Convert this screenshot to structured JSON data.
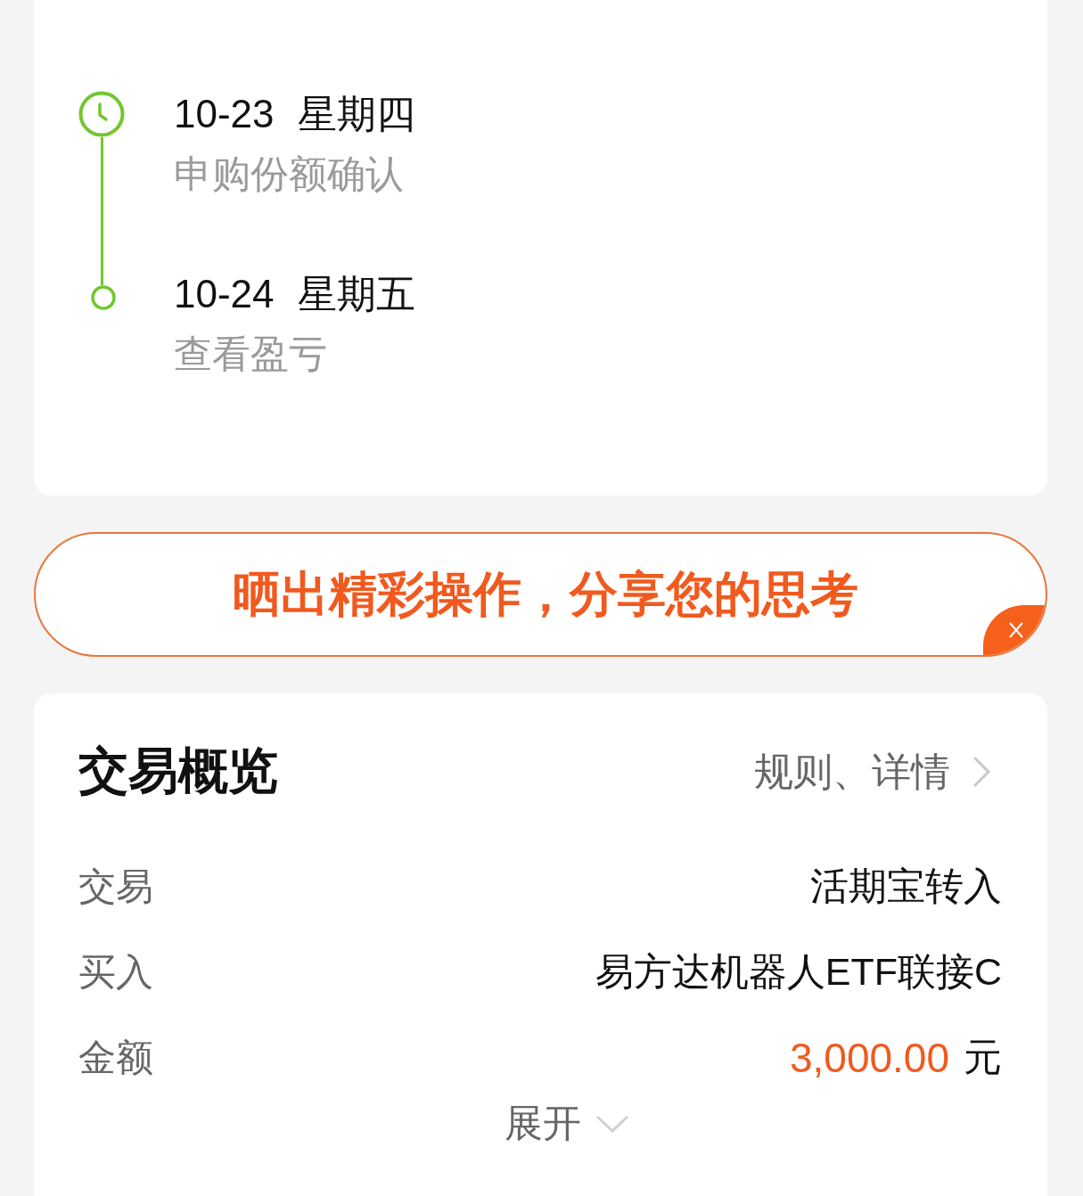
{
  "timeline": [
    {
      "kind": "clock",
      "date": "10-23",
      "weekday": "星期四",
      "description": "申购份额确认"
    },
    {
      "kind": "circle",
      "date": "10-24",
      "weekday": "星期五",
      "description": "查看盈亏"
    }
  ],
  "banner": {
    "text": "晒出精彩操作，分享您的思考"
  },
  "overview": {
    "title": "交易概览",
    "link": "规则、详情",
    "rows": [
      {
        "kind": "text",
        "label": "交易",
        "value": "活期宝转入"
      },
      {
        "kind": "text",
        "label": "买入",
        "value": "易方达机器人ETF联接C"
      },
      {
        "kind": "amount",
        "label": "金额",
        "value": "3,000.00",
        "unit": "元"
      }
    ],
    "expand": "展开"
  }
}
